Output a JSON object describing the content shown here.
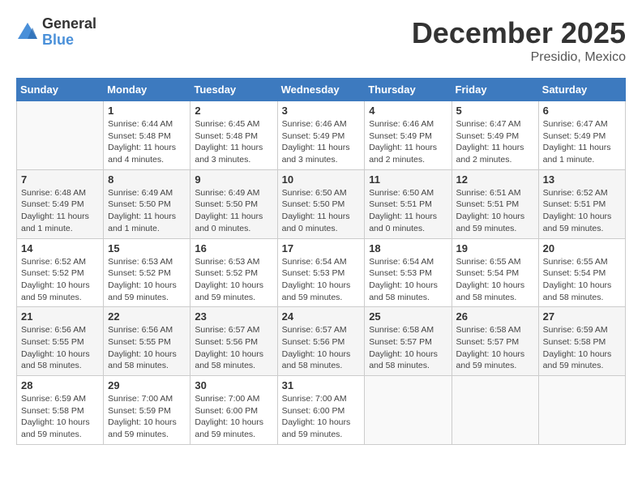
{
  "header": {
    "logo_general": "General",
    "logo_blue": "Blue",
    "title": "December 2025",
    "location": "Presidio, Mexico"
  },
  "calendar": {
    "days_of_week": [
      "Sunday",
      "Monday",
      "Tuesday",
      "Wednesday",
      "Thursday",
      "Friday",
      "Saturday"
    ],
    "weeks": [
      [
        {
          "day": "",
          "info": ""
        },
        {
          "day": "1",
          "info": "Sunrise: 6:44 AM\nSunset: 5:48 PM\nDaylight: 11 hours\nand 4 minutes."
        },
        {
          "day": "2",
          "info": "Sunrise: 6:45 AM\nSunset: 5:48 PM\nDaylight: 11 hours\nand 3 minutes."
        },
        {
          "day": "3",
          "info": "Sunrise: 6:46 AM\nSunset: 5:49 PM\nDaylight: 11 hours\nand 3 minutes."
        },
        {
          "day": "4",
          "info": "Sunrise: 6:46 AM\nSunset: 5:49 PM\nDaylight: 11 hours\nand 2 minutes."
        },
        {
          "day": "5",
          "info": "Sunrise: 6:47 AM\nSunset: 5:49 PM\nDaylight: 11 hours\nand 2 minutes."
        },
        {
          "day": "6",
          "info": "Sunrise: 6:47 AM\nSunset: 5:49 PM\nDaylight: 11 hours\nand 1 minute."
        }
      ],
      [
        {
          "day": "7",
          "info": "Sunrise: 6:48 AM\nSunset: 5:49 PM\nDaylight: 11 hours\nand 1 minute."
        },
        {
          "day": "8",
          "info": "Sunrise: 6:49 AM\nSunset: 5:50 PM\nDaylight: 11 hours\nand 1 minute."
        },
        {
          "day": "9",
          "info": "Sunrise: 6:49 AM\nSunset: 5:50 PM\nDaylight: 11 hours\nand 0 minutes."
        },
        {
          "day": "10",
          "info": "Sunrise: 6:50 AM\nSunset: 5:50 PM\nDaylight: 11 hours\nand 0 minutes."
        },
        {
          "day": "11",
          "info": "Sunrise: 6:50 AM\nSunset: 5:51 PM\nDaylight: 11 hours\nand 0 minutes."
        },
        {
          "day": "12",
          "info": "Sunrise: 6:51 AM\nSunset: 5:51 PM\nDaylight: 10 hours\nand 59 minutes."
        },
        {
          "day": "13",
          "info": "Sunrise: 6:52 AM\nSunset: 5:51 PM\nDaylight: 10 hours\nand 59 minutes."
        }
      ],
      [
        {
          "day": "14",
          "info": "Sunrise: 6:52 AM\nSunset: 5:52 PM\nDaylight: 10 hours\nand 59 minutes."
        },
        {
          "day": "15",
          "info": "Sunrise: 6:53 AM\nSunset: 5:52 PM\nDaylight: 10 hours\nand 59 minutes."
        },
        {
          "day": "16",
          "info": "Sunrise: 6:53 AM\nSunset: 5:52 PM\nDaylight: 10 hours\nand 59 minutes."
        },
        {
          "day": "17",
          "info": "Sunrise: 6:54 AM\nSunset: 5:53 PM\nDaylight: 10 hours\nand 59 minutes."
        },
        {
          "day": "18",
          "info": "Sunrise: 6:54 AM\nSunset: 5:53 PM\nDaylight: 10 hours\nand 58 minutes."
        },
        {
          "day": "19",
          "info": "Sunrise: 6:55 AM\nSunset: 5:54 PM\nDaylight: 10 hours\nand 58 minutes."
        },
        {
          "day": "20",
          "info": "Sunrise: 6:55 AM\nSunset: 5:54 PM\nDaylight: 10 hours\nand 58 minutes."
        }
      ],
      [
        {
          "day": "21",
          "info": "Sunrise: 6:56 AM\nSunset: 5:55 PM\nDaylight: 10 hours\nand 58 minutes."
        },
        {
          "day": "22",
          "info": "Sunrise: 6:56 AM\nSunset: 5:55 PM\nDaylight: 10 hours\nand 58 minutes."
        },
        {
          "day": "23",
          "info": "Sunrise: 6:57 AM\nSunset: 5:56 PM\nDaylight: 10 hours\nand 58 minutes."
        },
        {
          "day": "24",
          "info": "Sunrise: 6:57 AM\nSunset: 5:56 PM\nDaylight: 10 hours\nand 58 minutes."
        },
        {
          "day": "25",
          "info": "Sunrise: 6:58 AM\nSunset: 5:57 PM\nDaylight: 10 hours\nand 58 minutes."
        },
        {
          "day": "26",
          "info": "Sunrise: 6:58 AM\nSunset: 5:57 PM\nDaylight: 10 hours\nand 59 minutes."
        },
        {
          "day": "27",
          "info": "Sunrise: 6:59 AM\nSunset: 5:58 PM\nDaylight: 10 hours\nand 59 minutes."
        }
      ],
      [
        {
          "day": "28",
          "info": "Sunrise: 6:59 AM\nSunset: 5:58 PM\nDaylight: 10 hours\nand 59 minutes."
        },
        {
          "day": "29",
          "info": "Sunrise: 7:00 AM\nSunset: 5:59 PM\nDaylight: 10 hours\nand 59 minutes."
        },
        {
          "day": "30",
          "info": "Sunrise: 7:00 AM\nSunset: 6:00 PM\nDaylight: 10 hours\nand 59 minutes."
        },
        {
          "day": "31",
          "info": "Sunrise: 7:00 AM\nSunset: 6:00 PM\nDaylight: 10 hours\nand 59 minutes."
        },
        {
          "day": "",
          "info": ""
        },
        {
          "day": "",
          "info": ""
        },
        {
          "day": "",
          "info": ""
        }
      ]
    ]
  }
}
